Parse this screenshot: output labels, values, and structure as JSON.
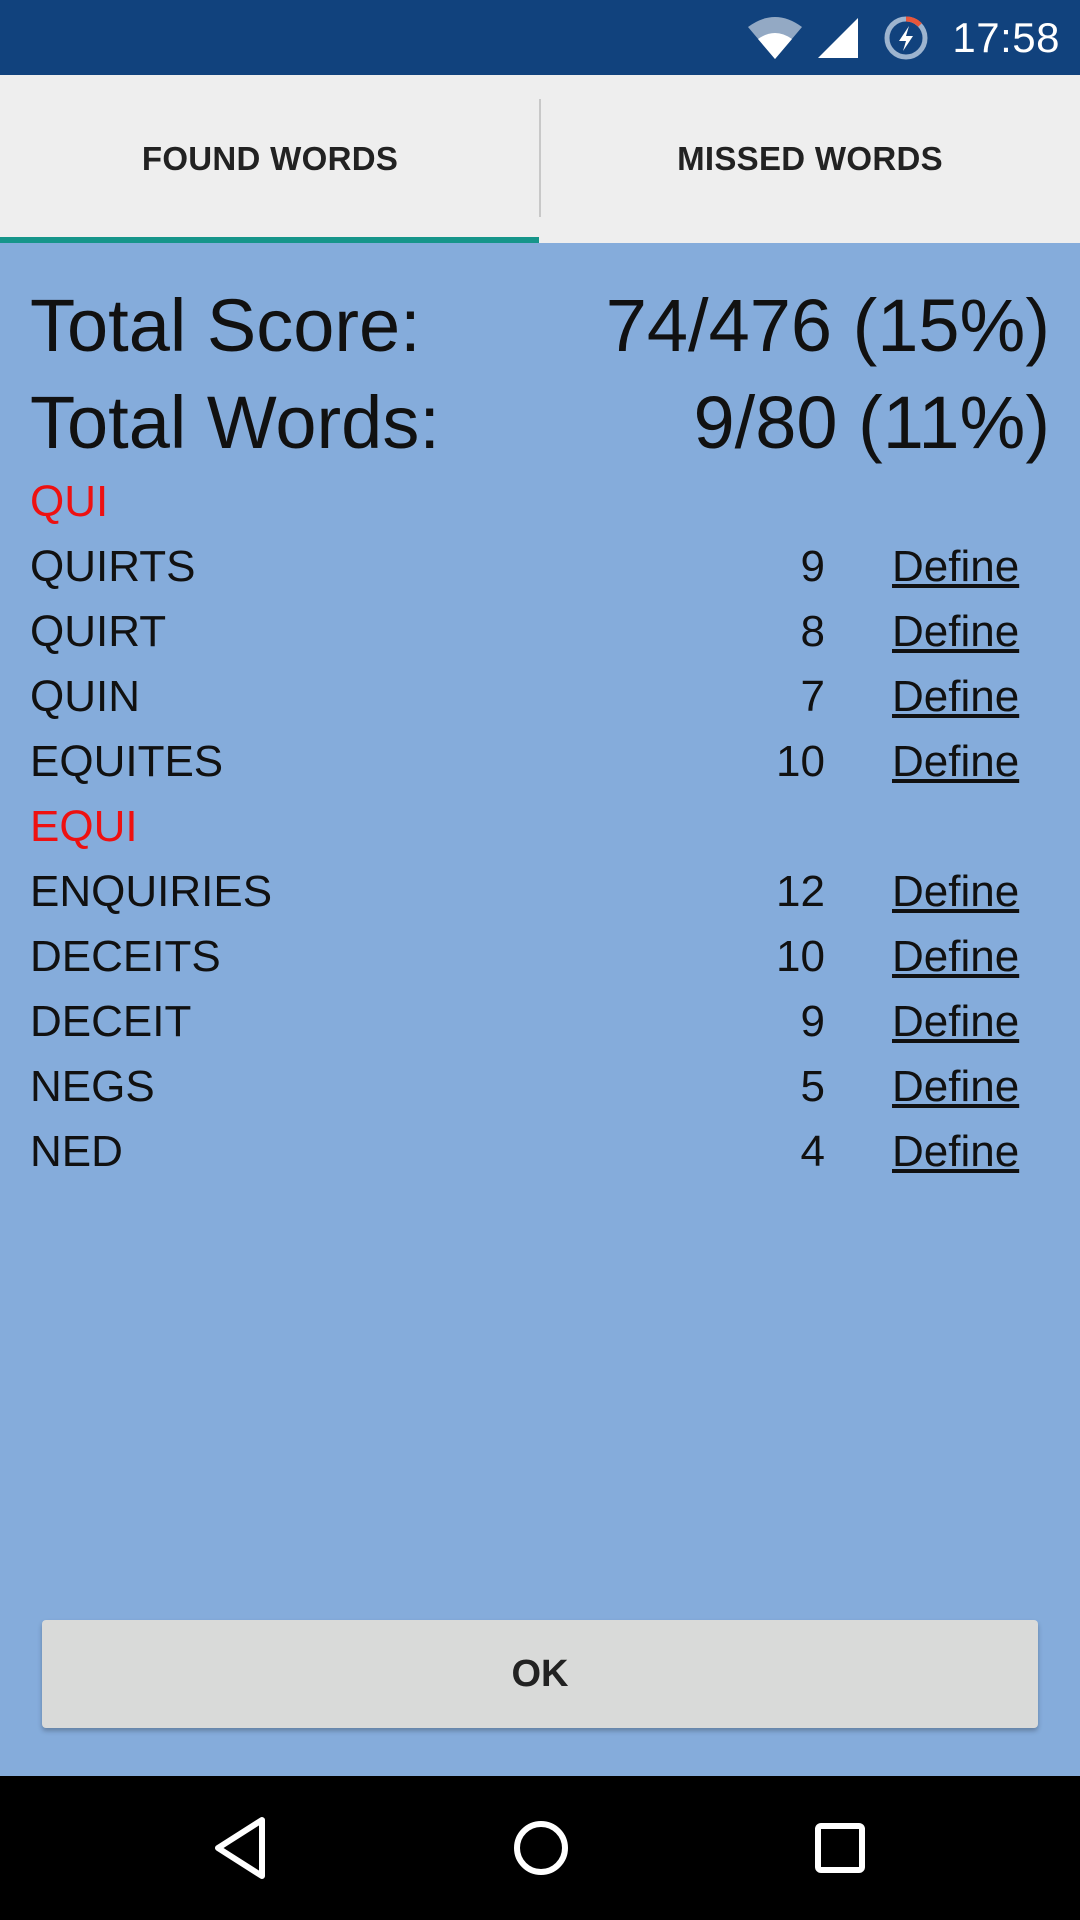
{
  "status_bar": {
    "time": "17:58",
    "icons": [
      "wifi-icon",
      "cell-signal-icon",
      "battery-saver-icon"
    ],
    "background": "#11427d"
  },
  "tabs": [
    {
      "label": "FOUND WORDS",
      "selected": true
    },
    {
      "label": "MISSED WORDS",
      "selected": false
    }
  ],
  "tab_indicator_color": "#16958a",
  "totals": {
    "score_label": "Total Score:",
    "score_value": "74/476 (15%)",
    "words_label": "Total Words:",
    "words_value": "9/80 (11%)"
  },
  "group_heading_color": "#ee1111",
  "groups": [
    {
      "heading": "QUI",
      "words": [
        {
          "word": "QUIRTS",
          "score": "9",
          "action": "Define"
        },
        {
          "word": "QUIRT",
          "score": "8",
          "action": "Define"
        },
        {
          "word": "QUIN",
          "score": "7",
          "action": "Define"
        },
        {
          "word": "EQUITES",
          "score": "10",
          "action": "Define"
        }
      ]
    },
    {
      "heading": "EQUI",
      "words": [
        {
          "word": "ENQUIRIES",
          "score": "12",
          "action": "Define"
        },
        {
          "word": "DECEITS",
          "score": "10",
          "action": "Define"
        },
        {
          "word": "DECEIT",
          "score": "9",
          "action": "Define"
        },
        {
          "word": "NEGS",
          "score": "5",
          "action": "Define"
        },
        {
          "word": "NED",
          "score": "4",
          "action": "Define"
        }
      ]
    }
  ],
  "ok_button": {
    "label": "OK"
  },
  "nav_bar": {
    "icons": [
      "back-icon",
      "home-icon",
      "recents-icon"
    ]
  }
}
